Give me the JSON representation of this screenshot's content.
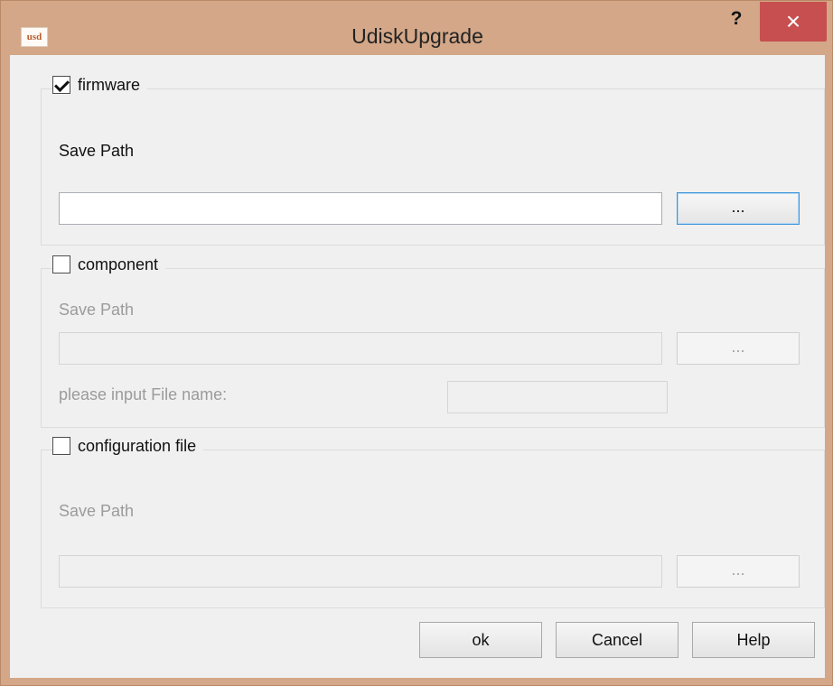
{
  "window": {
    "title": "UdiskUpgrade",
    "app_icon_text": "usd",
    "help_symbol": "?",
    "close_symbol": "×"
  },
  "sections": {
    "firmware": {
      "label": "firmware",
      "checked": true,
      "save_path_label": "Save Path",
      "save_path_value": "",
      "browse_label": "..."
    },
    "component": {
      "label": "component",
      "checked": false,
      "save_path_label": "Save Path",
      "save_path_value": "",
      "browse_label": "...",
      "file_name_label": "please input File name:",
      "file_name_value": ""
    },
    "configuration_file": {
      "label": "configuration file",
      "checked": false,
      "save_path_label": "Save Path",
      "save_path_value": "",
      "browse_label": "..."
    }
  },
  "buttons": {
    "ok": "ok",
    "cancel": "Cancel",
    "help": "Help"
  },
  "colors": {
    "title_bar": "#d3a788",
    "close_button": "#c74f4f",
    "dialog_background": "#f0f0f0",
    "focus_border": "#3c94d8"
  },
  "icons": {
    "app": "usd-logo-icon",
    "help": "question-mark-icon",
    "close": "close-icon",
    "checked": "checkmark-icon"
  }
}
